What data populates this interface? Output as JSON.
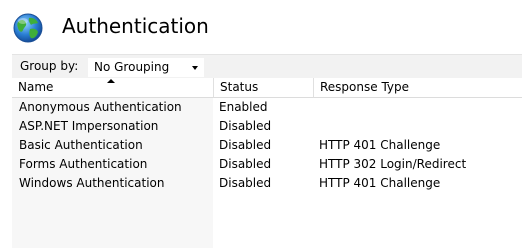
{
  "header": {
    "title": "Authentication",
    "icon": "globe-icon"
  },
  "toolbar": {
    "group_label": "Group by:",
    "group_value": "No Grouping"
  },
  "table": {
    "columns": [
      "Name",
      "Status",
      "Response Type"
    ],
    "sorted_column": "Name",
    "sort_direction": "ascending",
    "rows": [
      {
        "name": "Anonymous Authentication",
        "status": "Enabled",
        "response_type": ""
      },
      {
        "name": "ASP.NET Impersonation",
        "status": "Disabled",
        "response_type": ""
      },
      {
        "name": "Basic Authentication",
        "status": "Disabled",
        "response_type": "HTTP 401 Challenge"
      },
      {
        "name": "Forms Authentication",
        "status": "Disabled",
        "response_type": "HTTP 302 Login/Redirect"
      },
      {
        "name": "Windows Authentication",
        "status": "Disabled",
        "response_type": "HTTP 401 Challenge"
      }
    ]
  }
}
